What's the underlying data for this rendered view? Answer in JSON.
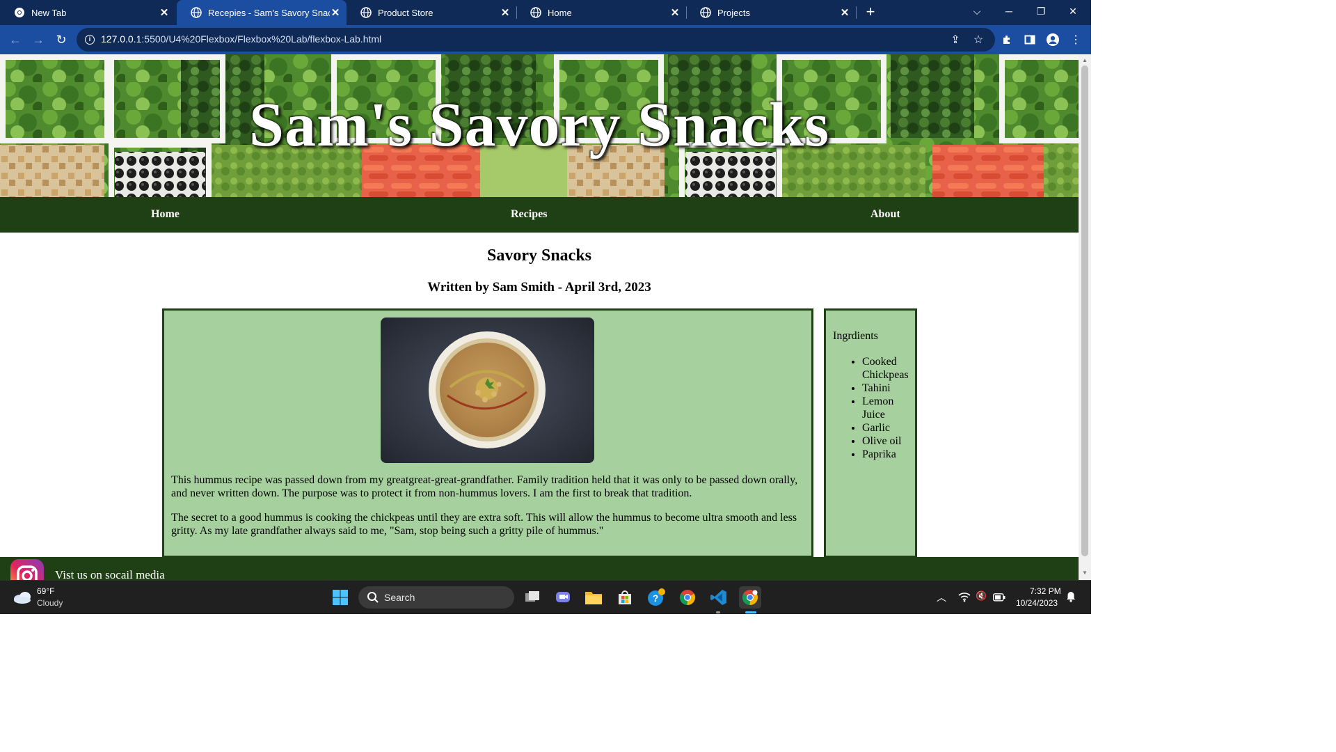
{
  "browser": {
    "tabs": [
      {
        "title": "New Tab",
        "icon": "chrome-icon",
        "active": false
      },
      {
        "title": "Recepies - Sam's Savory Snacks",
        "icon": "globe-icon",
        "active": true
      },
      {
        "title": "Product Store",
        "icon": "globe-icon",
        "active": false
      },
      {
        "title": "Home",
        "icon": "globe-icon",
        "active": false
      },
      {
        "title": "Projects",
        "icon": "globe-icon",
        "active": false
      }
    ],
    "url_host": "127.0.0.1",
    "url_rest": ":5500/U4%20Flexbox/Flexbox%20Lab/flexbox-Lab.html"
  },
  "page": {
    "site_title": "Sam's Savory Snacks",
    "nav": {
      "home": "Home",
      "recipes": "Recipes",
      "about": "About"
    },
    "heading": "Savory Snacks",
    "byline": "Written by Sam Smith - April 3rd, 2023",
    "paragraphs": [
      "This hummus recipe was passed down from my greatgreat-great-grandfather. Family tradition held that it was only to be passed down orally, and never written down. The purpose was to protect it from non-hummus lovers. I am the first to break that tradition.",
      "The secret to a good hummus is cooking the chickpeas until they are extra soft. This will allow the hummus to become ultra smooth and less gritty. As my late grandfather always said to me, \"Sam, stop being such a gritty pile of hummus.\""
    ],
    "ingredients_title": "Ingrdients",
    "ingredients": [
      "Cooked Chickpeas",
      "Tahini",
      "Lemon Juice",
      "Garlic",
      "Olive oil",
      "Paprika"
    ],
    "footer_text": "Vist us on socail media"
  },
  "taskbar": {
    "weather_temp": "69°F",
    "weather_desc": "Cloudy",
    "search_label": "Search",
    "time": "7:32 PM",
    "date": "10/24/2023"
  },
  "colors": {
    "tabbar": "#0f2a57",
    "toolbar": "#1b4ea0",
    "site_nav": "#1f3f14",
    "content_box": "#a6d09d"
  }
}
